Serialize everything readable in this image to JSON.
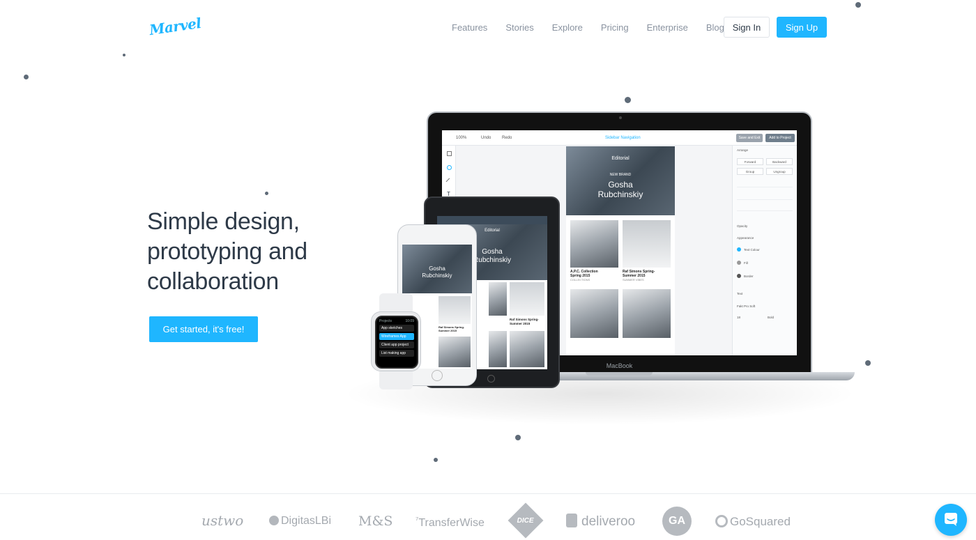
{
  "brand": {
    "logo_text": "Marvel",
    "accent_color": "#1fb6ff"
  },
  "nav": {
    "links": [
      "Features",
      "Stories",
      "Explore",
      "Pricing",
      "Enterprise",
      "Blog"
    ],
    "signin_label": "Sign In",
    "signup_label": "Sign Up"
  },
  "hero": {
    "title_lines": [
      "Simple design,",
      "prototyping and",
      "collaboration"
    ],
    "cta_label": "Get started, it's free!"
  },
  "devices": {
    "macbook_label": "MacBook",
    "app_toolbar": {
      "zoom": "100%",
      "undo": "Undo",
      "redo": "Redo",
      "doc_name": "Sidebar Navigation",
      "save_exit": "Save and Exit",
      "add_to_project": "Add to Project"
    },
    "app_panel": {
      "arrange": "Arrange",
      "forward": "Forward",
      "backward": "Backward",
      "group": "Group",
      "ungroup": "Ungroup",
      "opacity": "Opacity",
      "appearance": "Appearance",
      "text_colour": "Text Colour",
      "fill": "Fill",
      "border": "Border",
      "text": "Text",
      "font": "Fakt Pro Soft",
      "size": "18",
      "weight": "Bold"
    },
    "editorial": {
      "header": "Editorial",
      "kicker": "NEW BRAND",
      "name_line1": "Gosha",
      "name_line2": "Rubchinskiy",
      "caption1_line1": "A.P.C. Collection",
      "caption1_line2": "Spring 2015",
      "caption1_tag": "COLLECTIONS",
      "caption2_line1": "Raf Simons Spring-",
      "caption2_line2": "Summer 2015",
      "caption2_tag": "SUMMER VIBES"
    },
    "watch": {
      "title": "Projects",
      "time": "10:09",
      "items": [
        "App sketches",
        "Wireframes App",
        "Client app project",
        "List making app"
      ],
      "active_index": 1
    }
  },
  "clients": [
    "ustwo",
    "DigitasLBi",
    "M&S",
    "TransferWise",
    "DICE",
    "deliveroo",
    "GA",
    "GoSquared"
  ]
}
